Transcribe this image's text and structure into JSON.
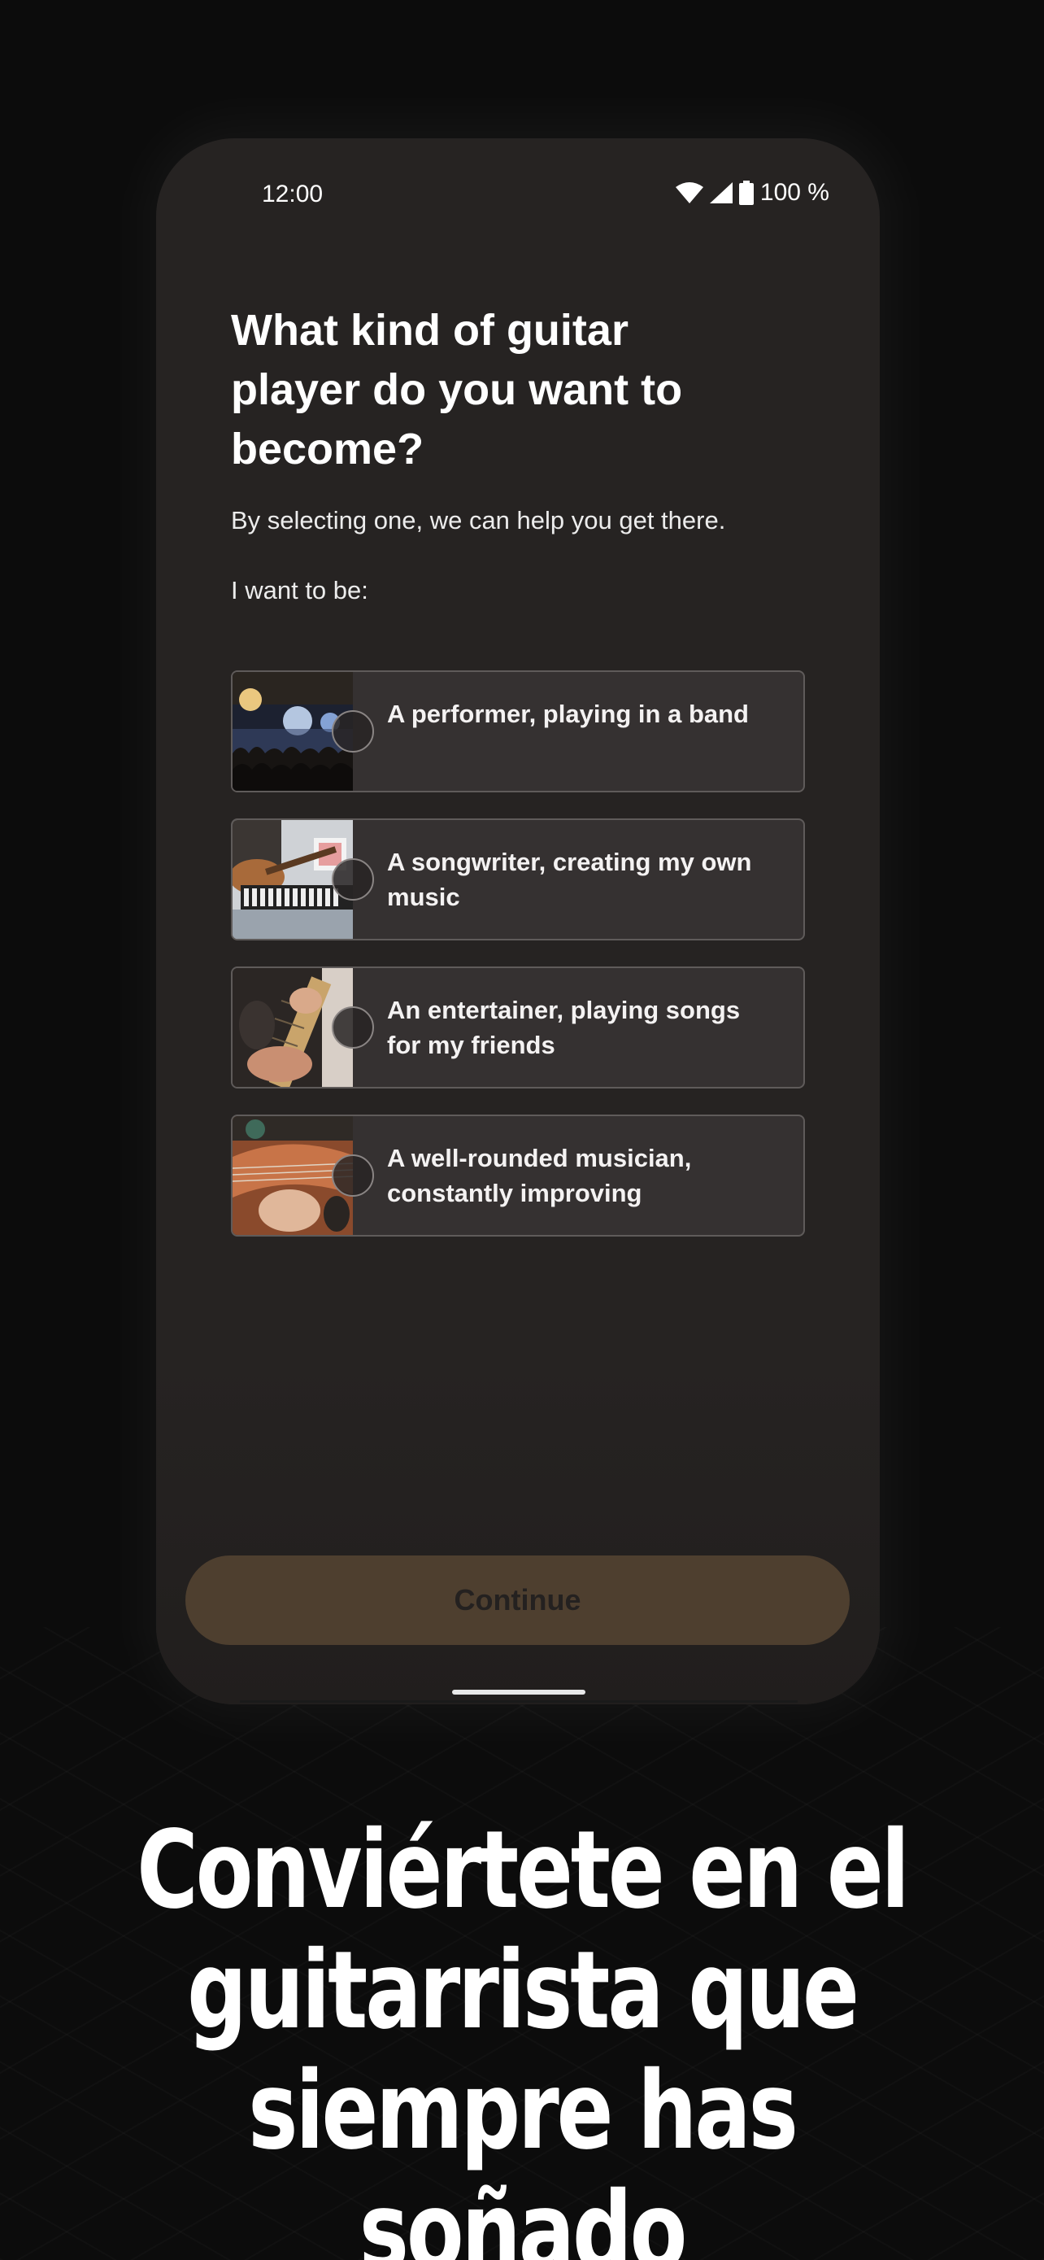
{
  "status_bar": {
    "time": "12:00",
    "battery": "100 %"
  },
  "screen": {
    "title": "What kind of guitar player do you want to become?",
    "subtitle": "By selecting one, we can help you get there.",
    "prompt": "I want to be:",
    "options": [
      {
        "label": "A performer, playing in a band",
        "image": "concert-crowd-photo"
      },
      {
        "label": "A songwriter, creating my own music",
        "image": "guitar-keyboard-photo"
      },
      {
        "label": "An entertainer, playing songs for my friends",
        "image": "guitar-neck-hands-photo"
      },
      {
        "label": "A well-rounded musician, constantly improving",
        "image": "guitar-headstock-photo"
      }
    ],
    "continue_label": "Continue"
  },
  "headline": {
    "line1": "Conviértete en el",
    "line2": "guitarrista que",
    "line3": "siempre has soñado"
  },
  "colors": {
    "page_background": "#0c0c0c",
    "phone_background": "#262322",
    "option_background": "#353131",
    "continue_button": "#4e3f2f"
  }
}
